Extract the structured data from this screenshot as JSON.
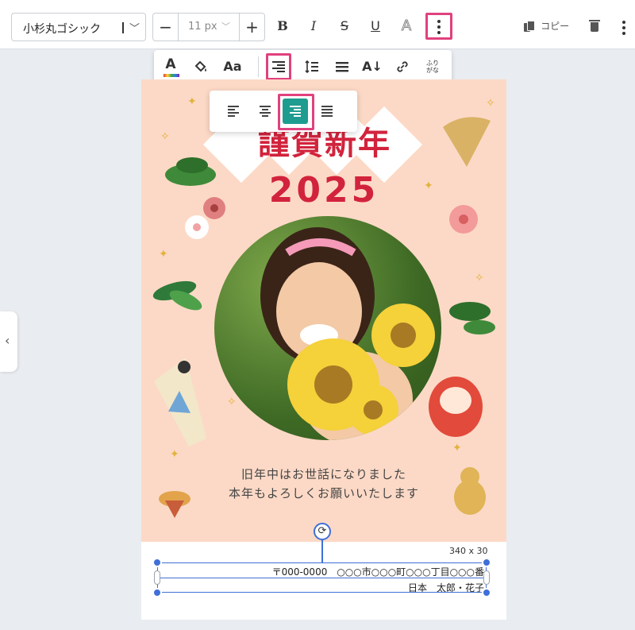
{
  "toolbar": {
    "font_family": "小杉丸ゴシック",
    "font_size": "11 px",
    "minus_label": "−",
    "plus_label": "+",
    "bold": "B",
    "italic": "I",
    "strike": "S",
    "underline": "U",
    "outline": "A",
    "copy_label": "コピー"
  },
  "format_bar": {
    "color_letter": "A",
    "text_style": "Aa",
    "vertical_label": "A↓",
    "furigana_top": "ふり",
    "furigana_bottom": "がな"
  },
  "card": {
    "title": "謹賀新年",
    "year": "2025",
    "greeting_line1": "旧年中はお世話になりました",
    "greeting_line2": "本年もよろしくお願いいたします",
    "colors": {
      "background": "#fcd9c6",
      "accent": "#d2233c",
      "selection": "#3f6fd8",
      "highlight": "#e0417e",
      "active_align": "#1e9c8f"
    }
  },
  "selection": {
    "dimensions": "340 x 30",
    "address_line1": "〒000-0000　○○○市○○○町○○○丁目○○○番",
    "address_line2": "日本　太郎・花子"
  },
  "icons": {
    "side_tab": "chevron-left-icon",
    "rotate": "rotate-icon"
  }
}
